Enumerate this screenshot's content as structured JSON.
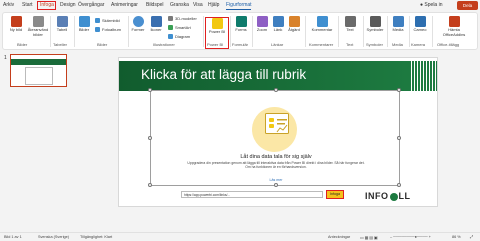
{
  "menu": {
    "items": [
      "Arkiv",
      "Start",
      "Infoga",
      "Design",
      "Övergångar",
      "Animeringar",
      "Bildspel",
      "Granska",
      "Visa",
      "Hjälp",
      "Figurformat"
    ],
    "active": "Infoga",
    "present_label": "Spela in",
    "share_label": "Dela"
  },
  "ribbon": {
    "groups": [
      "Bilder",
      "Tabeller",
      "Bilder",
      "Illustrationer",
      "Power BI",
      "Formulär",
      "Länkar",
      "Kommentarer",
      "Text",
      "Symboler",
      "Media",
      "Kamera",
      "Office-tillägg"
    ],
    "new_slide": "Ny bild",
    "reuse_slides": "Återanvänd bilder",
    "table": "Tabell",
    "pictures": "Bilder",
    "screenshot": "Skärmbild",
    "photo_album": "Fotoalbum",
    "shapes": "Former",
    "icons": "Ikoner",
    "models_3d": "3D-modeller",
    "smartart": "SmartArt",
    "chart": "Diagram",
    "power_bi": "Power BI",
    "forms": "Forms",
    "zoom": "Zoom",
    "link": "Länk",
    "action": "Åtgärd",
    "comment": "Kommentar",
    "text": "Text",
    "symbols": "Symboler",
    "media": "Media",
    "cameo": "Cameo",
    "office_addins": "Hämta OfficeAddins"
  },
  "thumbnails": {
    "number": "1"
  },
  "slide": {
    "title": "Klicka för att lägga till rubrik",
    "heading": "Låt dina data tala för sig själv",
    "description": "Uppgradera din presentation genom att lägga till interaktiva data från Power BI direkt i dina bilder. Så här fungerar det. Om ha funktionen är en förhandsversion.",
    "link": "Läs mer",
    "url_value": "https://app.powerbi.com/links/...",
    "insert_label": "Infoga",
    "logo_left": "INFO",
    "logo_right": "LL"
  },
  "status": {
    "slide_of": "Bild 1 av 1",
    "language": "Svenska (Sverige)",
    "accessibility": "Tillgänglighet: Klart",
    "notes": "Anteckningar",
    "zoom": "86 %"
  },
  "colors": {
    "accent": "#c43e1c",
    "title_band": "#1a6b3a",
    "highlight": "#e02020",
    "insert_button": "#f4c21b"
  }
}
